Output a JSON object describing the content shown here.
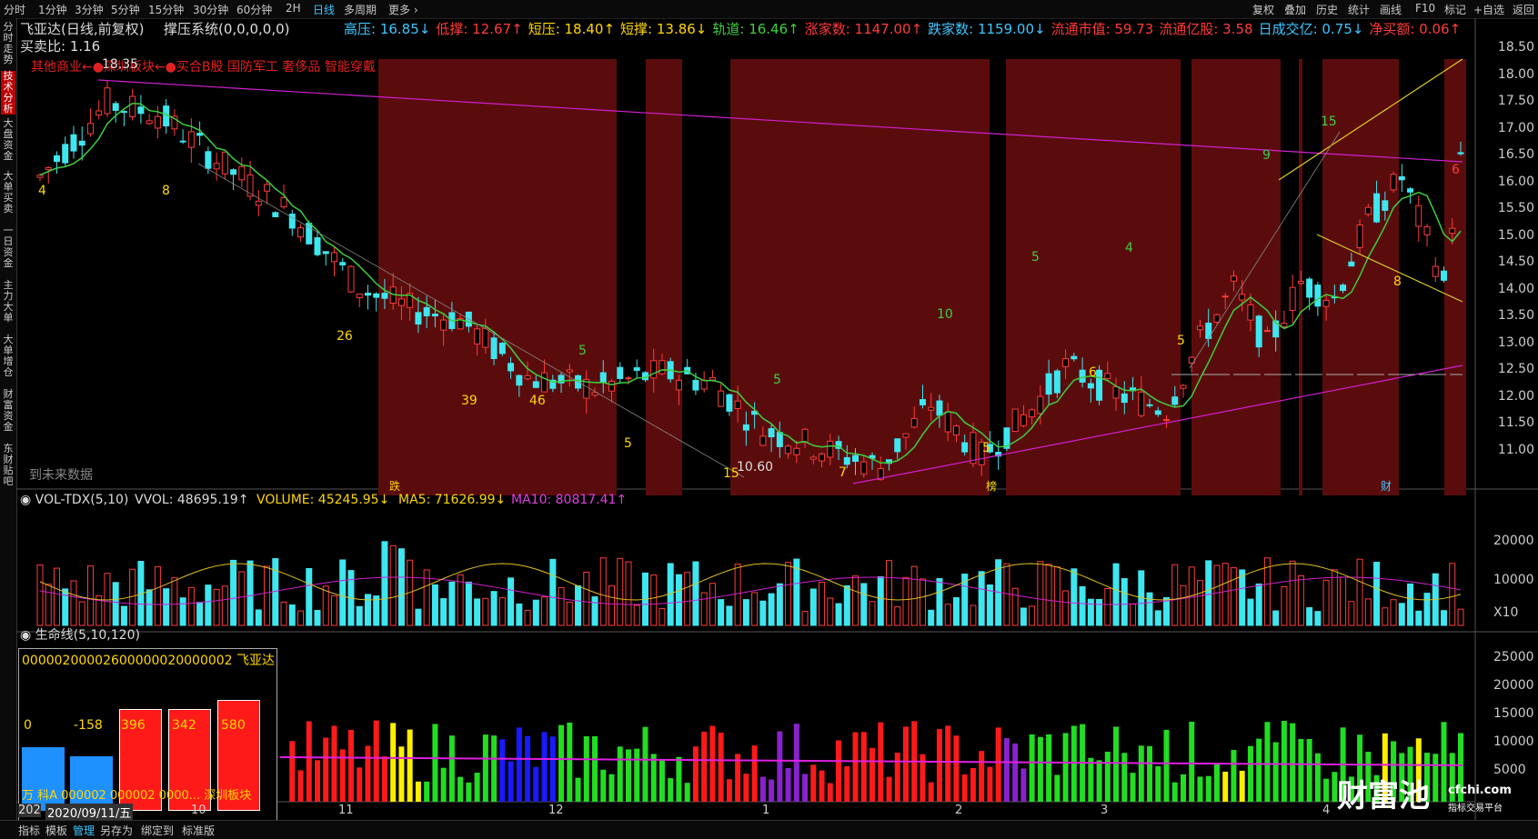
{
  "toolbar": {
    "periods": [
      "分时",
      "1分钟",
      "3分钟",
      "5分钟",
      "15分钟",
      "30分钟",
      "60分钟",
      "2H",
      "日线",
      "多周期",
      "更多 ›"
    ],
    "active_period": "日线",
    "right": [
      "复权",
      "叠加",
      "历史",
      "统计",
      "画线",
      "F10",
      "标记",
      "+自选",
      "返回"
    ]
  },
  "left_tabs": [
    "分时走势",
    "技术分析",
    "大盘资金",
    "大单买卖",
    "一日资金",
    "主力大单",
    "大单增仓",
    "财富资金",
    "东财贴吧"
  ],
  "header": {
    "title": "飞亚达(日线,前复权)",
    "system": "撑压系统(0,0,0,0,0)",
    "buy_sell_ratio": "买卖比: 1.16",
    "stats": [
      {
        "label": "高压:",
        "value": "16.85↓",
        "color": "#3ec6ff"
      },
      {
        "label": "低撑:",
        "value": "12.67↑",
        "color": "#ff3b3b"
      },
      {
        "label": "短压:",
        "value": "18.40↑",
        "color": "#ffd700"
      },
      {
        "label": "短撑:",
        "value": "13.86↓",
        "color": "#ffd700"
      },
      {
        "label": "轨道:",
        "value": "16.46↑",
        "color": "#3ecf3e"
      },
      {
        "label": "涨家数:",
        "value": "1147.00↑",
        "color": "#ff3b3b"
      },
      {
        "label": "跌家数:",
        "value": "1159.00↓",
        "color": "#3ec6ff"
      },
      {
        "label": "流通市值:",
        "value": "59.73",
        "color": "#ff3b3b"
      },
      {
        "label": "流通亿股:",
        "value": "3.58",
        "color": "#ff3b3b"
      },
      {
        "label": "日成交亿:",
        "value": "0.75↓",
        "color": "#3ec6ff"
      },
      {
        "label": "净买额:",
        "value": "0.06↑",
        "color": "#ff3b3b"
      }
    ],
    "concepts": "其他商业←●深圳板块←●买合B股 国防军工 奢侈品 智能穿戴"
  },
  "price_axis": [
    "18.50",
    "18.00",
    "17.50",
    "17.00",
    "16.50",
    "16.00",
    "15.50",
    "15.00",
    "14.50",
    "14.00",
    "13.50",
    "13.00",
    "12.50",
    "12.00",
    "11.50",
    "11.00"
  ],
  "main_labels": {
    "high": "18.35",
    "low": "10.60",
    "future": "到未来数据",
    "markers": [
      "跌",
      "榜",
      "财"
    ],
    "counts": [
      "4",
      "8",
      "26",
      "39",
      "46",
      "5",
      "5",
      "5",
      "15",
      "7",
      "10",
      "5",
      "5",
      "4",
      "6",
      "5",
      "9",
      "15",
      "6",
      "8"
    ]
  },
  "volume": {
    "title": "VOL-TDX(5,10)",
    "vvol": "VVOL: 48695.19↑",
    "volume": "VOLUME: 45245.95↓",
    "ma5": "MA5: 71626.99↓",
    "ma10": "MA10: 80817.41↑",
    "axis": [
      "20000",
      "10000",
      "X10"
    ]
  },
  "lifeline": {
    "title": "生命线(5,10,120)",
    "axis": [
      "25000",
      "20000",
      "15000",
      "10000",
      "5000"
    ]
  },
  "infobox": {
    "code_line": "00000200002600000020000002 飞亚达",
    "values": [
      "0",
      "-158",
      "396",
      "342",
      "580"
    ],
    "bottom_text": "万 科A  000002 000002 0000... 深圳板块"
  },
  "date_axis": {
    "first": "202",
    "current": "2020/09/11/五",
    "months": [
      "10",
      "11",
      "12",
      "1",
      "2",
      "3",
      "4"
    ]
  },
  "bottom_bar": [
    "指标",
    "模板",
    "管理",
    "另存为",
    "绑定到",
    "标准版"
  ],
  "watermark": {
    "brand": "财富池",
    "url": "cfchi.com",
    "sub": "指标交易平台"
  }
}
